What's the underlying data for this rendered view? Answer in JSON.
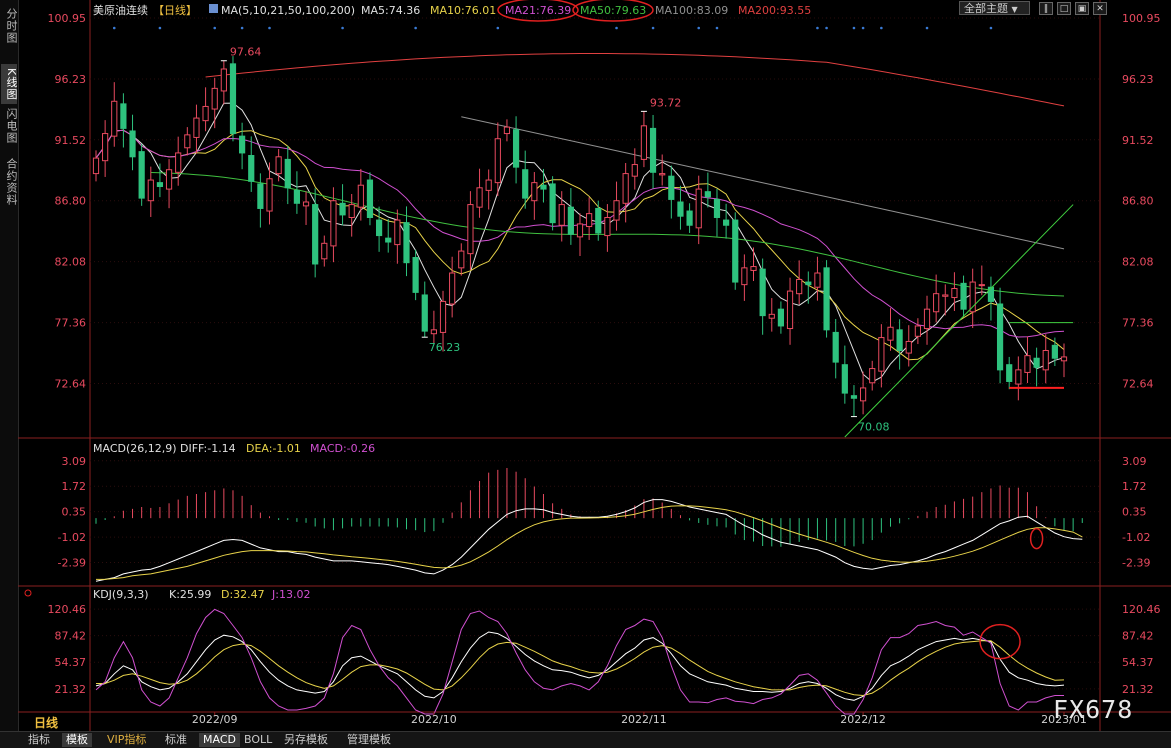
{
  "left_tabs": [
    "分时图",
    "K线图",
    "闪电图",
    "合约资料"
  ],
  "active_left_tab": 1,
  "header": {
    "instrument": "美原油连续",
    "period": "【日线】",
    "ma_title": "MA(5,10,21,50,100,200)",
    "ma_values": [
      {
        "label": "MA5:74.36",
        "color": "#e0e0e0"
      },
      {
        "label": "MA10:76.01",
        "color": "#e8d34a"
      },
      {
        "label": "MA21:76.39",
        "color": "#d050d0"
      },
      {
        "label": "MA50:79.63",
        "color": "#40c040"
      },
      {
        "label": "MA100:83.09",
        "color": "#909090"
      },
      {
        "label": "MA200:93.55",
        "color": "#e04040"
      }
    ],
    "theme_button": "全部主题"
  },
  "macd_header": {
    "title": "MACD(26,12,9)",
    "diff": "DIFF:-1.14",
    "dea": "DEA:-1.01",
    "macd": "MACD:-0.26"
  },
  "kdj_header": {
    "title": "KDJ(9,3,3)",
    "k": "K:25.99",
    "d": "D:32.47",
    "j": "J:13.02"
  },
  "bottom_tabs": [
    "指标",
    "模板",
    "VIP指标",
    "标准",
    "MACD",
    "BOLL",
    "另存模板",
    "管理模板"
  ],
  "active_bottom_tabs": [
    1,
    4
  ],
  "dayline_label": "日线",
  "watermark": "FX678",
  "colors": {
    "up": "#e84a5f",
    "down": "#2ec27e",
    "price_axis": "#e84a5f",
    "background": "#000000"
  },
  "chart_data": [
    {
      "type": "candlestick",
      "title": "美原油连续",
      "y_ticks": [
        100.95,
        96.23,
        91.52,
        86.8,
        82.08,
        77.36,
        72.64
      ],
      "ylim": [
        68.5,
        100.95
      ],
      "x_ticks": [
        "2022/09",
        "2022/10",
        "2022/11",
        "2022/12",
        "2023/01"
      ],
      "x_tick_index": [
        13,
        37,
        60,
        84,
        106
      ],
      "date_range": [
        "2022-08-12",
        "2023-01-13"
      ],
      "closes": [
        90.1,
        92.0,
        94.5,
        92.4,
        90.2,
        87.0,
        88.4,
        87.9,
        89.2,
        90.5,
        91.9,
        93.2,
        94.1,
        95.5,
        97.0,
        92.0,
        90.5,
        88.3,
        86.2,
        88.5,
        90.2,
        87.8,
        86.6,
        86.7,
        81.9,
        83.5,
        86.8,
        85.7,
        86.5,
        88.0,
        85.5,
        84.1,
        83.6,
        85.3,
        82.0,
        79.7,
        76.7,
        76.8,
        79.0,
        81.2,
        82.9,
        86.5,
        87.8,
        88.4,
        91.6,
        92.5,
        89.4,
        87.0,
        88.2,
        87.7,
        85.1,
        86.5,
        84.2,
        85.0,
        85.8,
        84.3,
        85.5,
        86.8,
        88.9,
        89.6,
        92.6,
        89.0,
        88.9,
        86.9,
        85.6,
        84.9,
        87.7,
        87.1,
        85.5,
        84.9,
        80.5,
        81.6,
        81.7,
        77.9,
        78.0,
        77.1,
        79.8,
        80.7,
        80.3,
        81.2,
        76.8,
        74.3,
        71.9,
        71.5,
        72.3,
        73.8,
        76.2,
        77.0,
        75.2,
        75.9,
        77.1,
        78.4,
        79.6,
        79.5,
        80.0,
        78.4,
        80.5,
        80.3,
        79.0,
        73.7,
        72.8,
        73.7,
        74.8,
        73.9,
        75.2,
        74.6,
        74.7
      ],
      "highlighted_values": [
        {
          "label": "97.64",
          "value": 97.64,
          "type": "high"
        },
        {
          "label": "76.23",
          "value": 76.23,
          "type": "low"
        },
        {
          "label": "93.72",
          "value": 93.72,
          "type": "high"
        },
        {
          "label": "70.08",
          "value": 70.08,
          "type": "low"
        }
      ],
      "series": [
        {
          "name": "MA5",
          "color": "#e0e0e0"
        },
        {
          "name": "MA10",
          "color": "#e8d34a"
        },
        {
          "name": "MA21",
          "color": "#d050d0"
        },
        {
          "name": "MA50",
          "color": "#40c040"
        },
        {
          "name": "MA100",
          "color": "#909090"
        },
        {
          "name": "MA200",
          "color": "#e04040"
        }
      ]
    },
    {
      "type": "bar",
      "title": "MACD(26,12,9)",
      "y_ticks": [
        3.09,
        1.72,
        0.35,
        -1.02,
        -2.39
      ],
      "ylim": [
        -3.6,
        3.4
      ],
      "series": [
        {
          "name": "DIFF",
          "color": "#ffffff",
          "values": [
            -3.4,
            -3.3,
            -3.2,
            -3.0,
            -2.9,
            -2.8,
            -2.75,
            -2.6,
            -2.4,
            -2.2,
            -2.0,
            -1.8,
            -1.6,
            -1.4,
            -1.2,
            -1.15,
            -1.2,
            -1.4,
            -1.6,
            -1.7,
            -1.8,
            -1.8,
            -1.9,
            -1.95,
            -2.1,
            -2.2,
            -2.3,
            -2.3,
            -2.3,
            -2.35,
            -2.4,
            -2.45,
            -2.5,
            -2.6,
            -2.7,
            -2.8,
            -2.95,
            -3.0,
            -2.8,
            -2.5,
            -2.1,
            -1.6,
            -1.1,
            -0.6,
            -0.2,
            0.2,
            0.4,
            0.5,
            0.5,
            0.45,
            0.3,
            0.2,
            0.1,
            0.05,
            0.05,
            0.05,
            0.1,
            0.2,
            0.35,
            0.55,
            0.85,
            1.0,
            1.0,
            0.9,
            0.75,
            0.6,
            0.5,
            0.4,
            0.3,
            0.2,
            -0.1,
            -0.4,
            -0.6,
            -0.9,
            -1.1,
            -1.3,
            -1.4,
            -1.5,
            -1.6,
            -1.7,
            -1.9,
            -2.1,
            -2.4,
            -2.6,
            -2.7,
            -2.75,
            -2.65,
            -2.55,
            -2.5,
            -2.4,
            -2.3,
            -2.15,
            -1.95,
            -1.8,
            -1.6,
            -1.4,
            -1.2,
            -0.9,
            -0.6,
            -0.3,
            -0.15,
            0.05,
            0.1,
            -0.2,
            -0.5,
            -0.8,
            -1.0,
            -1.1,
            -1.14
          ]
        },
        {
          "name": "DEA",
          "color": "#e8d34a",
          "values": [
            -3.3,
            -3.3,
            -3.25,
            -3.2,
            -3.1,
            -3.05,
            -3.0,
            -2.9,
            -2.8,
            -2.7,
            -2.6,
            -2.45,
            -2.3,
            -2.15,
            -2.0,
            -1.9,
            -1.8,
            -1.75,
            -1.75,
            -1.75,
            -1.76,
            -1.77,
            -1.8,
            -1.82,
            -1.87,
            -1.92,
            -1.98,
            -2.03,
            -2.08,
            -2.12,
            -2.17,
            -2.22,
            -2.27,
            -2.33,
            -2.4,
            -2.48,
            -2.57,
            -2.65,
            -2.68,
            -2.64,
            -2.53,
            -2.35,
            -2.1,
            -1.82,
            -1.5,
            -1.16,
            -0.85,
            -0.58,
            -0.36,
            -0.2,
            -0.1,
            -0.04,
            0.0,
            0.0,
            0.01,
            0.02,
            0.04,
            0.07,
            0.13,
            0.21,
            0.34,
            0.47,
            0.58,
            0.65,
            0.67,
            0.66,
            0.63,
            0.58,
            0.52,
            0.45,
            0.34,
            0.19,
            0.03,
            -0.15,
            -0.34,
            -0.53,
            -0.7,
            -0.86,
            -1.01,
            -1.15,
            -1.3,
            -1.46,
            -1.65,
            -1.84,
            -2.01,
            -2.16,
            -2.26,
            -2.32,
            -2.36,
            -2.37,
            -2.36,
            -2.32,
            -2.25,
            -2.16,
            -2.05,
            -1.92,
            -1.78,
            -1.6,
            -1.4,
            -1.18,
            -0.97,
            -0.77,
            -0.6,
            -0.52,
            -0.52,
            -0.58,
            -0.66,
            -0.75,
            -1.01
          ]
        },
        {
          "name": "MACD",
          "values": [
            -0.3,
            -0.1,
            0.1,
            0.4,
            0.5,
            0.6,
            0.55,
            0.6,
            0.8,
            1.0,
            1.2,
            1.3,
            1.4,
            1.5,
            1.6,
            1.5,
            1.2,
            0.7,
            0.3,
            0.1,
            -0.1,
            -0.1,
            -0.2,
            -0.25,
            -0.45,
            -0.55,
            -0.65,
            -0.55,
            -0.45,
            -0.45,
            -0.45,
            -0.45,
            -0.45,
            -0.5,
            -0.6,
            -0.65,
            -0.75,
            -0.7,
            -0.25,
            0.3,
            0.85,
            1.5,
            2.0,
            2.45,
            2.6,
            2.7,
            2.5,
            2.15,
            1.7,
            1.3,
            0.8,
            0.5,
            0.2,
            0.1,
            0.08,
            0.06,
            0.12,
            0.26,
            0.44,
            0.68,
            1.02,
            1.06,
            0.84,
            0.5,
            0.16,
            -0.12,
            -0.26,
            -0.36,
            -0.44,
            -0.5,
            -0.88,
            -1.18,
            -1.26,
            -1.5,
            -1.52,
            -1.54,
            -1.4,
            -1.28,
            -1.18,
            -1.1,
            -1.2,
            -1.28,
            -1.5,
            -1.52,
            -1.38,
            -1.18,
            -0.78,
            -0.46,
            -0.28,
            -0.06,
            0.12,
            0.34,
            0.6,
            0.72,
            0.9,
            1.04,
            1.16,
            1.4,
            1.6,
            1.76,
            1.64,
            1.64,
            1.4,
            0.64,
            0.04,
            -0.44,
            -0.68,
            -0.7,
            -0.26
          ]
        }
      ]
    },
    {
      "type": "line",
      "title": "KDJ(9,3,3)",
      "y_ticks": [
        120.46,
        87.42,
        54.37,
        21.32
      ],
      "ylim": [
        -5,
        128
      ],
      "series": [
        {
          "name": "K",
          "color": "#ffffff",
          "values": [
            25,
            28,
            40,
            50,
            45,
            30,
            24,
            20,
            22,
            30,
            40,
            55,
            70,
            82,
            88,
            86,
            80,
            70,
            55,
            42,
            32,
            25,
            20,
            18,
            16,
            18,
            30,
            50,
            60,
            62,
            56,
            50,
            45,
            40,
            30,
            20,
            12,
            10,
            18,
            35,
            55,
            72,
            85,
            92,
            90,
            84,
            74,
            64,
            56,
            50,
            45,
            44,
            42,
            38,
            35,
            38,
            45,
            55,
            65,
            72,
            82,
            85,
            78,
            65,
            50,
            40,
            35,
            30,
            28,
            26,
            22,
            20,
            18,
            18,
            17,
            18,
            22,
            28,
            30,
            28,
            22,
            14,
            9,
            7,
            12,
            22,
            38,
            50,
            55,
            62,
            70,
            75,
            80,
            82,
            84,
            82,
            84,
            82,
            80,
            58,
            42,
            35,
            32,
            28,
            26,
            25,
            26
          ]
        },
        {
          "name": "D",
          "color": "#e8d34a",
          "values": [
            28,
            28,
            32,
            38,
            40,
            37,
            33,
            29,
            27,
            28,
            32,
            40,
            50,
            61,
            70,
            75,
            77,
            75,
            68,
            59,
            50,
            42,
            35,
            29,
            25,
            22,
            25,
            33,
            42,
            49,
            51,
            51,
            49,
            46,
            41,
            34,
            27,
            21,
            20,
            25,
            35,
            47,
            60,
            71,
            77,
            79,
            78,
            73,
            68,
            62,
            56,
            52,
            49,
            45,
            42,
            41,
            42,
            46,
            52,
            59,
            67,
            73,
            75,
            72,
            65,
            57,
            50,
            43,
            38,
            34,
            30,
            27,
            24,
            22,
            20,
            20,
            20,
            23,
            25,
            26,
            25,
            21,
            17,
            14,
            13,
            16,
            23,
            32,
            40,
            47,
            55,
            62,
            68,
            73,
            77,
            79,
            80,
            81,
            81,
            73,
            63,
            54,
            47,
            41,
            36,
            32,
            32.47
          ]
        },
        {
          "name": "J",
          "color": "#d050d0",
          "values": [
            20,
            30,
            60,
            80,
            60,
            20,
            5,
            0,
            10,
            35,
            60,
            90,
            110,
            120,
            115,
            100,
            85,
            60,
            30,
            10,
            0,
            -5,
            -5,
            -3,
            0,
            10,
            40,
            85,
            100,
            95,
            70,
            50,
            35,
            25,
            10,
            -5,
            -10,
            -10,
            15,
            55,
            95,
            115,
            118,
            110,
            105,
            90,
            66,
            45,
            30,
            22,
            20,
            25,
            28,
            25,
            20,
            30,
            50,
            75,
            95,
            100,
            108,
            105,
            85,
            50,
            20,
            5,
            5,
            4,
            8,
            10,
            6,
            5,
            3,
            8,
            10,
            15,
            26,
            38,
            40,
            32,
            16,
            0,
            -10,
            -10,
            8,
            35,
            70,
            85,
            85,
            90,
            100,
            102,
            105,
            100,
            98,
            88,
            92,
            85,
            78,
            28,
            0,
            -5,
            5,
            5,
            10,
            13,
            13.02
          ]
        }
      ]
    }
  ]
}
